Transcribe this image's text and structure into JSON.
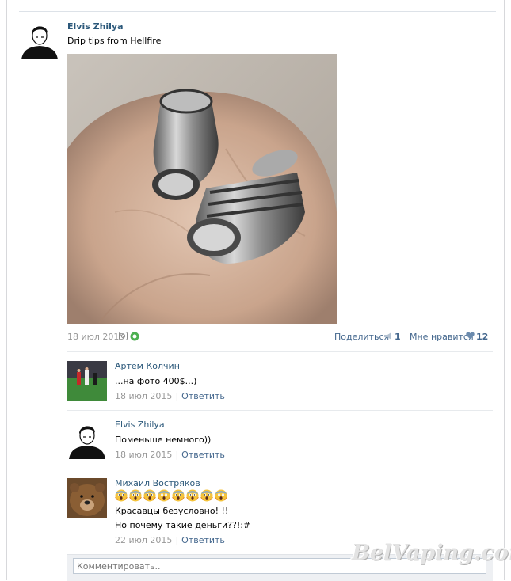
{
  "post": {
    "author": "Elvis Zhilya",
    "text": "Drip tips from Hellfire",
    "date": "18 июл 2015",
    "share_label": "Поделиться",
    "share_count": "1",
    "like_label": "Мне нравится",
    "like_count": "12"
  },
  "comments": [
    {
      "author": "Артем Колчин",
      "text": "...на фото 400$...)",
      "date": "18 июл 2015",
      "reply": "Ответить"
    },
    {
      "author": "Elvis Zhilya",
      "text": "Поменьше немного))",
      "date": "18 июл 2015",
      "reply": "Ответить"
    },
    {
      "author": "Михаил Востряков",
      "line2": "Красавцы безусловно! !!",
      "line3": "Но почему такие деньги??!:#",
      "date": "22 июл 2015",
      "reply": "Ответить",
      "emoji_icon": "screaming-face-emoji"
    }
  ],
  "comment_input": {
    "placeholder": "Комментировать.."
  },
  "watermark": "BelVaping.com",
  "colors": {
    "link": "#2b587a",
    "meta": "#999999",
    "action": "#45688e"
  }
}
